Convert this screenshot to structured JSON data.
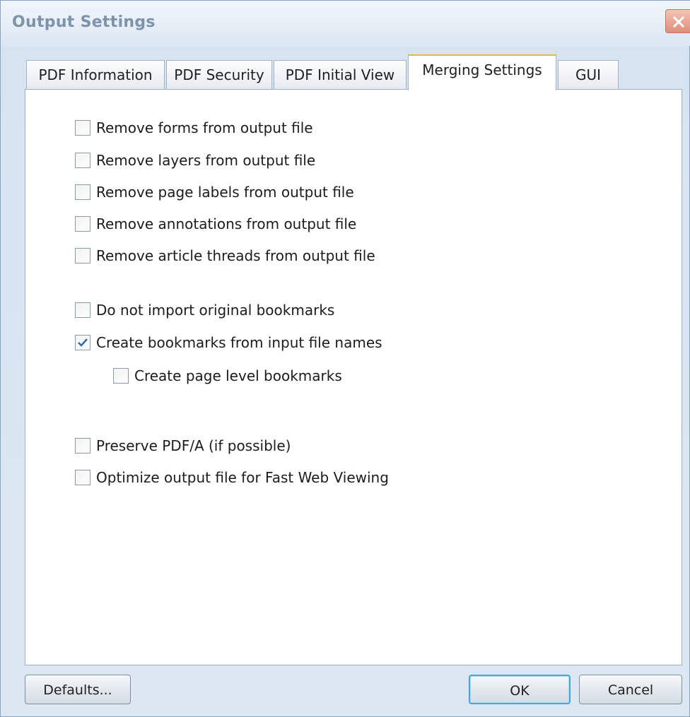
{
  "window": {
    "title": "Output Settings"
  },
  "tabs": [
    {
      "label": "PDF Information"
    },
    {
      "label": "PDF Security"
    },
    {
      "label": "PDF Initial View"
    },
    {
      "label": "Merging Settings",
      "active": true
    },
    {
      "label": "GUI"
    }
  ],
  "options": [
    {
      "label": "Remove forms from output file",
      "checked": false
    },
    {
      "label": "Remove layers from output file",
      "checked": false
    },
    {
      "label": "Remove page labels from output file",
      "checked": false
    },
    {
      "label": "Remove annotations from output file",
      "checked": false
    },
    {
      "label": "Remove article threads from output file",
      "checked": false
    },
    {
      "label": "Do not import original bookmarks",
      "checked": false
    },
    {
      "label": "Create bookmarks from input file names",
      "checked": true
    },
    {
      "label": "Create page level bookmarks",
      "checked": false
    },
    {
      "label": "Preserve PDF/A (if possible)",
      "checked": false
    },
    {
      "label": "Optimize output file for Fast Web Viewing",
      "checked": false
    }
  ],
  "buttons": {
    "defaults": "Defaults...",
    "ok": "OK",
    "cancel": "Cancel"
  },
  "colors": {
    "active_tab_accent": "#f5b63f",
    "ok_focus_border": "#4aa5d9",
    "close_button": "#e08d77"
  }
}
